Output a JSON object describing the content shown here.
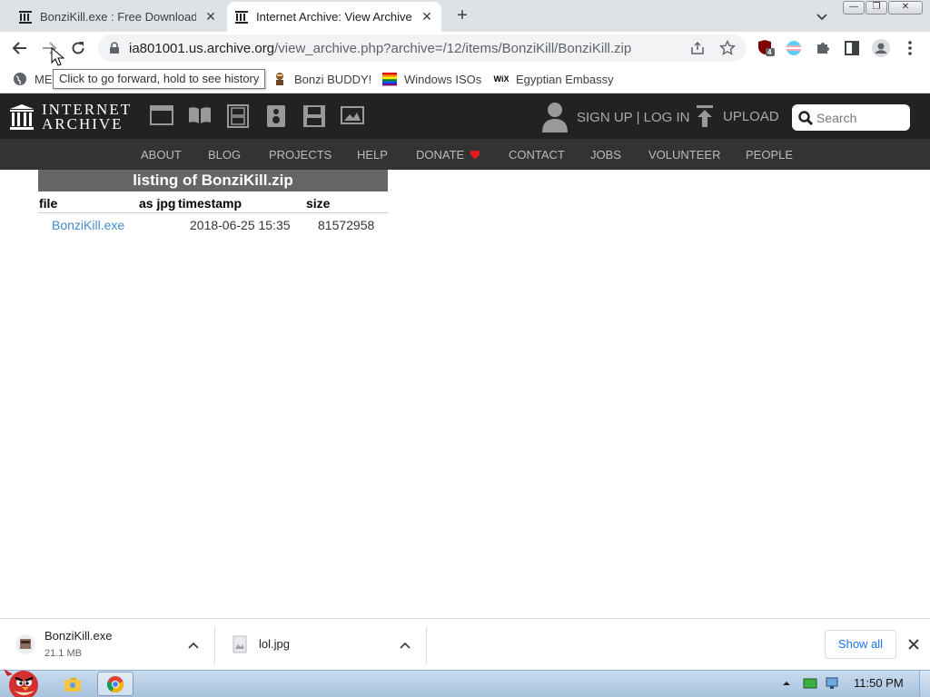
{
  "browser": {
    "tabs": [
      {
        "title": "BonziKill.exe : Free Download,",
        "active": false
      },
      {
        "title": "Internet Archive: View Archive",
        "active": true
      }
    ],
    "url_host": "ia801001.us.archive.org",
    "url_path": "/view_archive.php?archive=/12/items/BonziKill/BonziKill.zip",
    "extension_badge": "4",
    "tooltip": "Click to go forward, hold to see history",
    "bookmarks": [
      {
        "label": "ME",
        "icon": "globe-icon"
      },
      {
        "label": "Bonzi BUDDY!",
        "icon": "bonzi-icon"
      },
      {
        "label": "Windows ISOs",
        "icon": "windows-icon"
      },
      {
        "label": "Egyptian Embassy",
        "icon": "wix-icon"
      }
    ]
  },
  "ia": {
    "logo_line1": "INTERNET",
    "logo_line2": "ARCHIVE",
    "signup": "SIGN UP | LOG IN",
    "upload": "UPLOAD",
    "search_placeholder": "Search",
    "nav": [
      "ABOUT",
      "BLOG",
      "PROJECTS",
      "HELP",
      "DONATE",
      "CONTACT",
      "JOBS",
      "VOLUNTEER",
      "PEOPLE"
    ],
    "accent": "#e21b1b"
  },
  "listing": {
    "title": "listing of BonziKill.zip",
    "headers": [
      "file",
      "as jpg",
      "timestamp",
      "size"
    ],
    "rows": [
      {
        "file": "BonziKill.exe",
        "as_jpg": "",
        "timestamp": "2018-06-25 15:35",
        "size": "81572958"
      }
    ]
  },
  "downloads": {
    "items": [
      {
        "name": "BonziKill.exe",
        "size": "21.1 MB"
      },
      {
        "name": "lol.jpg",
        "size": ""
      }
    ],
    "show_all": "Show all"
  },
  "taskbar": {
    "clock": "11:50 PM"
  }
}
